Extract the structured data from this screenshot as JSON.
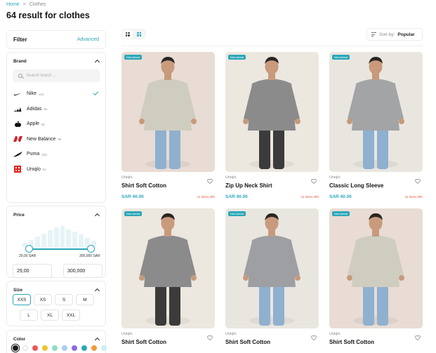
{
  "breadcrumb": {
    "home": "Home",
    "separator": ">",
    "current": "Clothes"
  },
  "page_title": "64 result for clothes",
  "filter": {
    "title": "Filter",
    "advanced": "Advanced"
  },
  "brand": {
    "title": "Brand",
    "search_placeholder": "Search brand ...",
    "items": [
      {
        "name": "Nike",
        "count": "123",
        "logo": "nike-swoosh",
        "selected": true
      },
      {
        "name": "Adidas",
        "count": "55",
        "logo": "adidas-stripes",
        "selected": false
      },
      {
        "name": "Apple",
        "count": "65",
        "logo": "apple-logo",
        "selected": false
      },
      {
        "name": "New Balance",
        "count": "99",
        "logo": "new-balance-logo",
        "selected": false
      },
      {
        "name": "Puma",
        "count": "325",
        "logo": "puma-logo",
        "selected": false
      },
      {
        "name": "Uniqlo",
        "count": "51",
        "logo": "uniqlo-logo",
        "selected": false
      }
    ]
  },
  "price": {
    "title": "Price",
    "min_label": "29,00 SAR",
    "max_label": "300,000 SAR",
    "min_value": "29,00",
    "max_value": "300,000"
  },
  "size": {
    "title": "Size",
    "options": [
      "XXS",
      "XS",
      "S",
      "M",
      "L",
      "XL",
      "XXL"
    ],
    "selected": "XXS"
  },
  "color": {
    "title": "Color",
    "swatches": [
      "#1a1a1a",
      "#ffffff",
      "#e85a5a",
      "#f2c230",
      "#8fdcc4",
      "#a6d0f2",
      "#8a6be6",
      "#2aa7b8",
      "#f29a3a",
      "#c9f0f2"
    ]
  },
  "toolbar": {
    "sort_label": "Sort by:",
    "sort_value": "Popular"
  },
  "products": [
    {
      "badge": "New Arrival",
      "brand": "Uniqlo",
      "name": "Shirt Soft Cotton",
      "price": "SAR 40.00",
      "stock": "12 items left!",
      "bg": "#e8dcd4",
      "top": "#cfcdc0",
      "pants": "#8fb0cf"
    },
    {
      "badge": "New Arrival",
      "brand": "Uniqlo",
      "name": "Zip Up Neck Shirt",
      "price": "SAR 40.00",
      "stock": "12 items left!",
      "bg": "#ece7df",
      "top": "#8b8b8b",
      "pants": "#3b3b3b"
    },
    {
      "badge": "New Arrival",
      "brand": "Uniqlo",
      "name": "Classic Long Sleeve",
      "price": "SAR 40.00",
      "stock": "12 items left!",
      "bg": "#e9e6e0",
      "top": "#a3a4a6",
      "pants": "#8fb0cf"
    },
    {
      "badge": "New Arrival",
      "brand": "Uniqlo",
      "name": "Shirt Soft Cotton",
      "price": "",
      "stock": "",
      "bg": "#ece7df",
      "top": "#8b8b8b",
      "pants": "#3b3b3b"
    },
    {
      "badge": "New Arrival",
      "brand": "Uniqlo",
      "name": "Shirt Soft Cotton",
      "price": "",
      "stock": "",
      "bg": "#e9e6e0",
      "top": "#9d9fa3",
      "pants": "#8fb0cf"
    },
    {
      "badge": "New Arrival",
      "brand": "Uniqlo",
      "name": "Shirt Soft Cotton",
      "price": "",
      "stock": "",
      "bg": "#e8dcd4",
      "top": "#cfcdc0",
      "pants": "#8fb0cf"
    }
  ]
}
